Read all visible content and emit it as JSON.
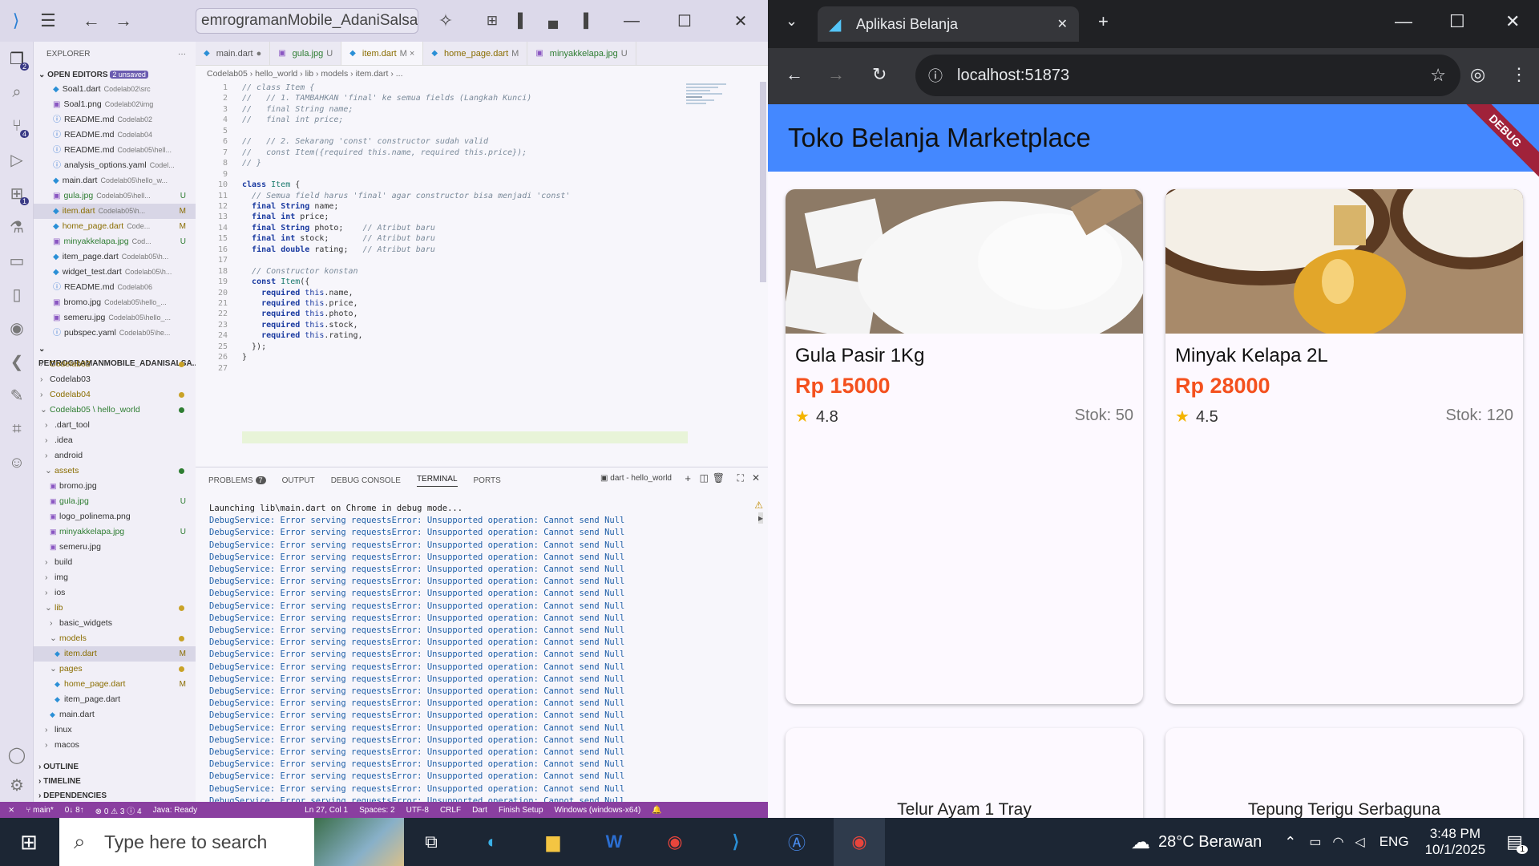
{
  "vscode": {
    "command_center": "emrogramanMobile_AdaniSalsabila",
    "explorer_title": "EXPLORER",
    "open_editors_label": "OPEN EDITORS",
    "unsaved_badge": "2 unsaved",
    "open_editors": [
      {
        "name": "Soal1.dart",
        "desc": "Codelab02\\src",
        "status": ""
      },
      {
        "name": "Soal1.png",
        "desc": "Codelab02\\img",
        "status": ""
      },
      {
        "name": "README.md",
        "desc": "Codelab02",
        "status": ""
      },
      {
        "name": "README.md",
        "desc": "Codelab04",
        "status": ""
      },
      {
        "name": "README.md",
        "desc": "Codelab05\\hell...",
        "status": ""
      },
      {
        "name": "analysis_options.yaml",
        "desc": "Codel...",
        "status": ""
      },
      {
        "name": "main.dart",
        "desc": "Codelab05\\hello_w...",
        "status": ""
      },
      {
        "name": "gula.jpg",
        "desc": "Codelab05\\hell...",
        "status": "U"
      },
      {
        "name": "item.dart",
        "desc": "Codelab05\\h...",
        "status": "M"
      },
      {
        "name": "home_page.dart",
        "desc": "Code...",
        "status": "M"
      },
      {
        "name": "minyakkelapa.jpg",
        "desc": "Cod...",
        "status": "U"
      },
      {
        "name": "item_page.dart",
        "desc": "Codelab05\\h...",
        "status": ""
      },
      {
        "name": "widget_test.dart",
        "desc": "Codelab05\\h...",
        "status": ""
      },
      {
        "name": "README.md",
        "desc": "Codelab06",
        "status": ""
      },
      {
        "name": "bromo.jpg",
        "desc": "Codelab05\\hello_...",
        "status": ""
      },
      {
        "name": "semeru.jpg",
        "desc": "Codelab05\\hello_...",
        "status": ""
      },
      {
        "name": "pubspec.yaml",
        "desc": "Codelab05\\he...",
        "status": ""
      }
    ],
    "workspace_label": "PEMROGRAMANMOBILE_ADANISALSA...",
    "tree": [
      {
        "name": "Codelab02",
        "depth": 0,
        "arrow": "›"
      },
      {
        "name": "Codelab03",
        "depth": 0,
        "arrow": "›"
      },
      {
        "name": "Codelab04",
        "depth": 0,
        "arrow": "›"
      },
      {
        "name": "Codelab05 \\ hello_world",
        "depth": 0,
        "arrow": "⌄"
      },
      {
        "name": ".dart_tool",
        "depth": 1,
        "arrow": "›"
      },
      {
        "name": ".idea",
        "depth": 1,
        "arrow": "›"
      },
      {
        "name": "android",
        "depth": 1,
        "arrow": "›"
      },
      {
        "name": "assets",
        "depth": 1,
        "arrow": "⌄"
      },
      {
        "name": "bromo.jpg",
        "depth": 2,
        "arrow": ""
      },
      {
        "name": "gula.jpg",
        "depth": 2,
        "arrow": ""
      },
      {
        "name": "logo_polinema.png",
        "depth": 2,
        "arrow": ""
      },
      {
        "name": "minyakkelapa.jpg",
        "depth": 2,
        "arrow": ""
      },
      {
        "name": "semeru.jpg",
        "depth": 2,
        "arrow": ""
      },
      {
        "name": "build",
        "depth": 1,
        "arrow": "›"
      },
      {
        "name": "img",
        "depth": 1,
        "arrow": "›"
      },
      {
        "name": "ios",
        "depth": 1,
        "arrow": "›"
      },
      {
        "name": "lib",
        "depth": 1,
        "arrow": "⌄"
      },
      {
        "name": "basic_widgets",
        "depth": 2,
        "arrow": "›"
      },
      {
        "name": "models",
        "depth": 2,
        "arrow": "⌄"
      },
      {
        "name": "item.dart",
        "depth": 3,
        "arrow": ""
      },
      {
        "name": "pages",
        "depth": 2,
        "arrow": "⌄"
      },
      {
        "name": "home_page.dart",
        "depth": 3,
        "arrow": ""
      },
      {
        "name": "item_page.dart",
        "depth": 3,
        "arrow": ""
      },
      {
        "name": "main.dart",
        "depth": 2,
        "arrow": ""
      },
      {
        "name": "linux",
        "depth": 1,
        "arrow": "›"
      },
      {
        "name": "macos",
        "depth": 1,
        "arrow": "›"
      }
    ],
    "outline_label": "OUTLINE",
    "timeline_label": "TIMELINE",
    "dependencies_label": "DEPENDENCIES",
    "tabs": [
      {
        "name": "main.dart",
        "flag": "●"
      },
      {
        "name": "gula.jpg",
        "flag": "U"
      },
      {
        "name": "item.dart",
        "flag": "M ×"
      },
      {
        "name": "home_page.dart",
        "flag": "M"
      },
      {
        "name": "minyakkelapa.jpg",
        "flag": "U"
      }
    ],
    "breadcrumb": "Codelab05 › hello_world › lib › models › item.dart › ...",
    "code_lines": [
      "// class Item {",
      "//   // 1. TAMBAHKAN 'final' ke semua fields (Langkah Kunci)",
      "//   final String name;",
      "//   final int price;",
      "",
      "//   // 2. Sekarang 'const' constructor sudah valid",
      "//   const Item({required this.name, required this.price});",
      "// }",
      "",
      "class Item {",
      "  // Semua field harus 'final' agar constructor bisa menjadi 'const'",
      "  final String name;",
      "  final int price;",
      "  final String photo;    // Atribut baru",
      "  final int stock;       // Atribut baru",
      "  final double rating;   // Atribut baru",
      "",
      "  // Constructor konstan",
      "  const Item({",
      "    required this.name,",
      "    required this.price,",
      "    required this.photo,",
      "    required this.stock,",
      "    required this.rating,",
      "  });",
      "}",
      ""
    ],
    "panel_tabs": [
      "PROBLEMS",
      "OUTPUT",
      "DEBUG CONSOLE",
      "TERMINAL",
      "PORTS"
    ],
    "problems_count": "7",
    "terminal_name": "dart - hello_world",
    "terminal_first": "Launching lib\\main.dart on Chrome in debug mode...",
    "terminal_error": "DebugService: Error serving requestsError: Unsupported operation: Cannot send Null",
    "terminal_error_count": 24,
    "status": {
      "branch": "main*",
      "sync": "0↓ 8↑",
      "problems": "⊗ 0 ⚠ 3 ⓘ 4",
      "java": "Java: Ready",
      "position": "Ln 27, Col 1",
      "spaces": "Spaces: 2",
      "encoding": "UTF-8",
      "eol": "CRLF",
      "language": "Dart",
      "finish": "Finish Setup",
      "platform": "Windows (windows-x64)"
    }
  },
  "chrome": {
    "tab_title": "Aplikasi Belanja",
    "url": "localhost:51873"
  },
  "app": {
    "title": "Toko Belanja Marketplace",
    "debug": "DEBUG",
    "products": [
      {
        "name": "Gula Pasir 1Kg",
        "price": "Rp 15000",
        "rating": "4.8",
        "stock": "Stok: 50"
      },
      {
        "name": "Minyak Kelapa 2L",
        "price": "Rp 28000",
        "rating": "4.5",
        "stock": "Stok: 120"
      }
    ],
    "partial_products": [
      "Telur Ayam 1 Tray",
      "Tepung Terigu Serbaguna"
    ]
  },
  "taskbar": {
    "search_placeholder": "Type here to search",
    "weather": "28°C  Berawan",
    "lang": "ENG",
    "time": "3:48 PM",
    "date": "10/1/2025",
    "notif": "1"
  }
}
